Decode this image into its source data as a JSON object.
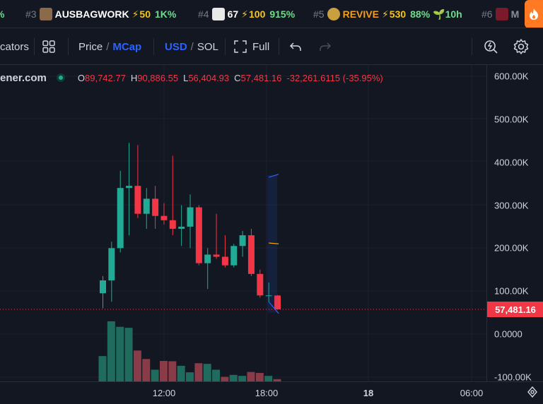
{
  "ticker": [
    {
      "rank": "",
      "symbol": "",
      "boost": "",
      "change": "%",
      "age": "",
      "avatar_color": "#6b5a3a"
    },
    {
      "rank": "#3",
      "symbol": "AUSBAGWORK",
      "boost": "50",
      "change": "1K%",
      "age": "",
      "avatar_color": "#8a6a4a"
    },
    {
      "rank": "#4",
      "symbol": "67",
      "boost": "100",
      "change": "915%",
      "age": "",
      "avatar_color": "#e8e8e8"
    },
    {
      "rank": "#5",
      "symbol": "REVIVE",
      "boost": "530",
      "change": "88%",
      "age": "10h",
      "avatar_color": "#c8a040"
    },
    {
      "rank": "#6",
      "symbol": "M",
      "boost": "",
      "change": "",
      "age": "",
      "avatar_color": "#7a1a2a"
    }
  ],
  "toolbar": {
    "indicators_label": "cators",
    "price_label": "Price",
    "mcap_label": "MCap",
    "usd_label": "USD",
    "sol_label": "SOL",
    "full_label": "Full"
  },
  "legend": {
    "source": "ener.com",
    "o_key": "O",
    "o_val": "89,742.77",
    "h_key": "H",
    "h_val": "90,886.55",
    "l_key": "L",
    "l_val": "56,404.93",
    "c_key": "C",
    "c_val": "57,481.16",
    "change": "-32,261.6115 (-35.95%)"
  },
  "colors": {
    "up": "#22ab94",
    "down": "#f23645",
    "up_volume": "#1f6b5e",
    "down_volume": "#8a3b48",
    "background": "#131722"
  },
  "chart_data": {
    "type": "candlestick",
    "y_unit": "market cap (USD)",
    "ylim": [
      -100000,
      640000
    ],
    "y_ticks": [
      "600.00K",
      "500.00K",
      "400.00K",
      "300.00K",
      "200.00K",
      "100.00K",
      "0.0000",
      "-100.00K"
    ],
    "x_ticks": [
      "12:00",
      "18:00",
      "18",
      "06:00"
    ],
    "last_price_label": "57,481.16",
    "last_price": 57481.16,
    "candles": [
      {
        "o": 95000,
        "h": 135000,
        "l": 60000,
        "c": 125000
      },
      {
        "o": 125000,
        "h": 215000,
        "l": 75000,
        "c": 200000
      },
      {
        "o": 200000,
        "h": 380000,
        "l": 190000,
        "c": 340000
      },
      {
        "o": 340000,
        "h": 445000,
        "l": 230000,
        "c": 345000
      },
      {
        "o": 345000,
        "h": 440000,
        "l": 270000,
        "c": 280000
      },
      {
        "o": 280000,
        "h": 340000,
        "l": 245000,
        "c": 315000
      },
      {
        "o": 315000,
        "h": 345000,
        "l": 245000,
        "c": 275000
      },
      {
        "o": 275000,
        "h": 305000,
        "l": 255000,
        "c": 265000
      },
      {
        "o": 265000,
        "h": 415000,
        "l": 230000,
        "c": 245000
      },
      {
        "o": 245000,
        "h": 300000,
        "l": 205000,
        "c": 250000
      },
      {
        "o": 250000,
        "h": 325000,
        "l": 200000,
        "c": 295000
      },
      {
        "o": 295000,
        "h": 300000,
        "l": 160000,
        "c": 165000
      },
      {
        "o": 165000,
        "h": 200000,
        "l": 105000,
        "c": 185000
      },
      {
        "o": 185000,
        "h": 280000,
        "l": 175000,
        "c": 180000
      },
      {
        "o": 180000,
        "h": 230000,
        "l": 155000,
        "c": 160000
      },
      {
        "o": 160000,
        "h": 210000,
        "l": 155000,
        "c": 205000
      },
      {
        "o": 205000,
        "h": 240000,
        "l": 180000,
        "c": 230000
      },
      {
        "o": 230000,
        "h": 245000,
        "l": 135000,
        "c": 140000
      },
      {
        "o": 140000,
        "h": 150000,
        "l": 85000,
        "c": 90000
      },
      {
        "o": 90000,
        "h": 120000,
        "l": 75000,
        "c": 90000
      },
      {
        "o": 89742.77,
        "h": 90886.55,
        "l": 56404.93,
        "c": 57481.16
      }
    ],
    "volumes": [
      {
        "v": 78000,
        "up": true
      },
      {
        "v": 185000,
        "up": true
      },
      {
        "v": 168000,
        "up": true
      },
      {
        "v": 165000,
        "up": true
      },
      {
        "v": 95000,
        "up": false
      },
      {
        "v": 69000,
        "up": false
      },
      {
        "v": 36000,
        "up": true
      },
      {
        "v": 63000,
        "up": false
      },
      {
        "v": 62000,
        "up": false
      },
      {
        "v": 48000,
        "up": true
      },
      {
        "v": 28000,
        "up": true
      },
      {
        "v": 56000,
        "up": false
      },
      {
        "v": 54000,
        "up": true
      },
      {
        "v": 36000,
        "up": true
      },
      {
        "v": 14000,
        "up": false
      },
      {
        "v": 20000,
        "up": true
      },
      {
        "v": 17000,
        "up": true
      },
      {
        "v": 29000,
        "up": false
      },
      {
        "v": 26000,
        "up": false
      },
      {
        "v": 17000,
        "up": true
      },
      {
        "v": 7000,
        "up": false
      }
    ]
  }
}
